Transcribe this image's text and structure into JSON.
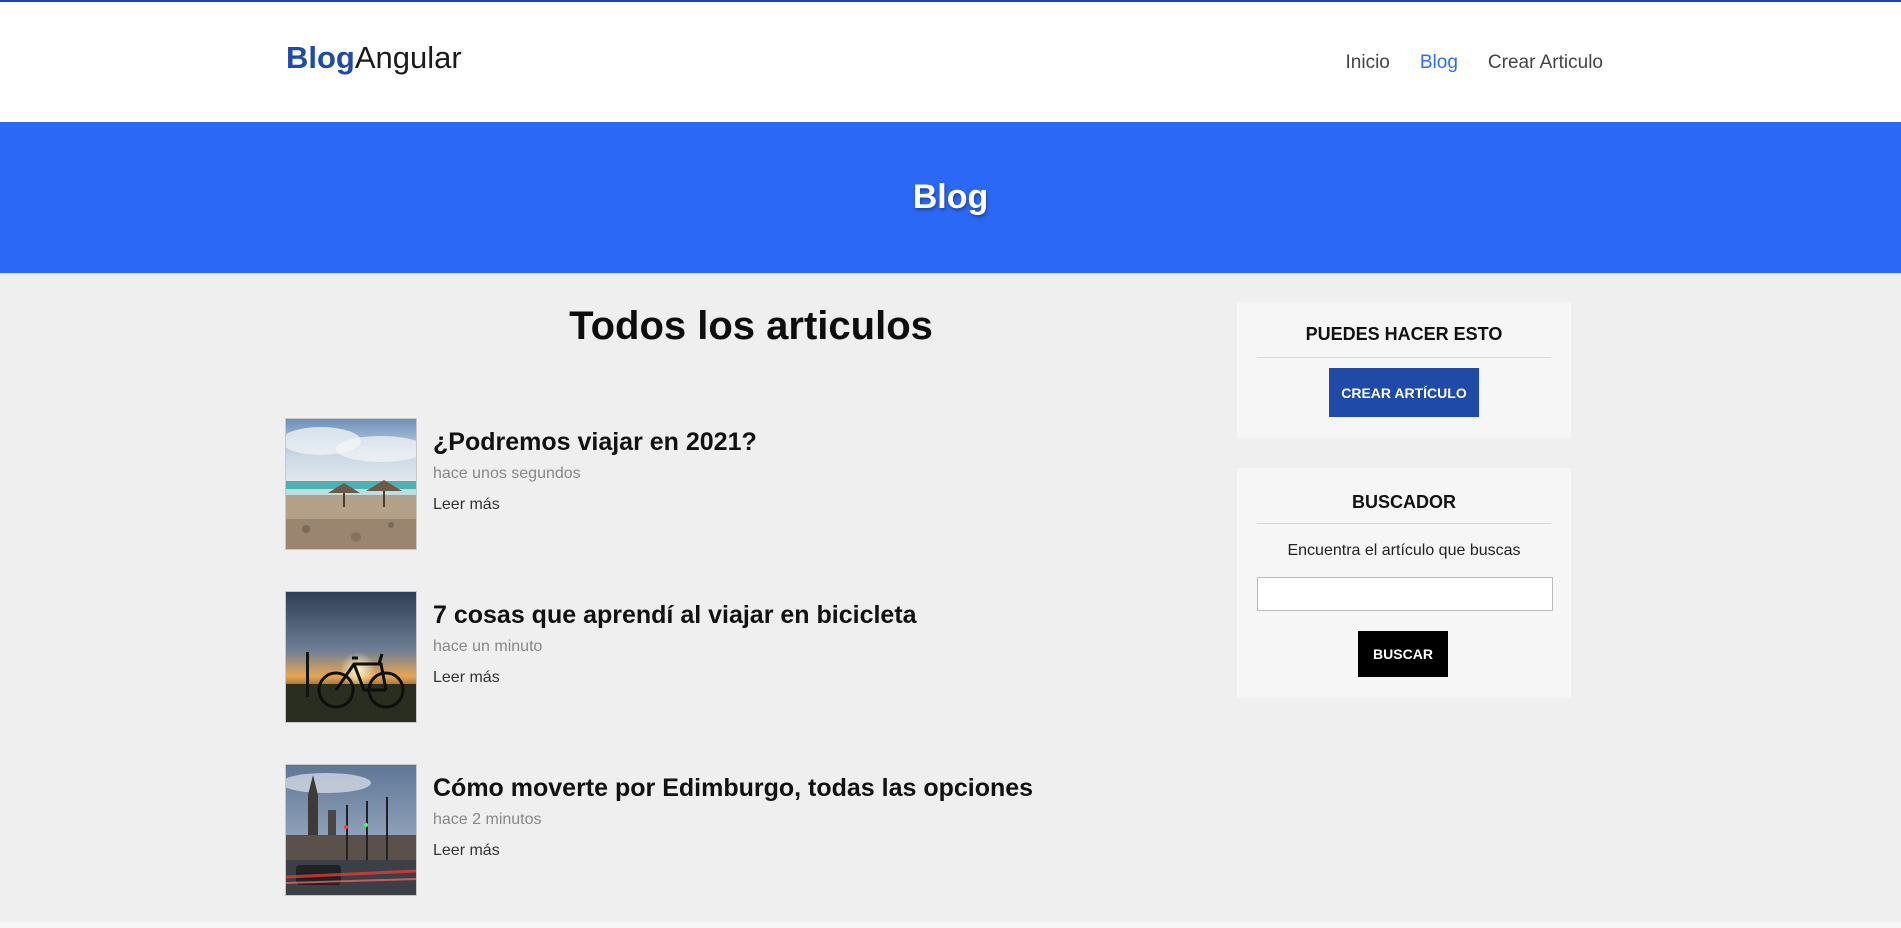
{
  "brand": {
    "part1": "Blog",
    "part2": "Angular"
  },
  "nav": [
    {
      "label": "Inicio",
      "active": false
    },
    {
      "label": "Blog",
      "active": true
    },
    {
      "label": "Crear Articulo",
      "active": false
    }
  ],
  "hero": {
    "title": "Blog"
  },
  "main": {
    "title": "Todos los articulos"
  },
  "articles": [
    {
      "title": "¿Podremos viajar en 2021?",
      "time": "hace unos segundos",
      "more": "Leer más",
      "image": "beach-umbrellas-photo"
    },
    {
      "title": "7 cosas que aprendí al viajar en bicicleta",
      "time": "hace un minuto",
      "more": "Leer más",
      "image": "bicycle-sunset-photo"
    },
    {
      "title": "Cómo moverte por Edimburgo, todas las opciones",
      "time": "hace 2 minutos",
      "more": "Leer más",
      "image": "edinburgh-street-photo"
    }
  ],
  "sidebar": {
    "actions": {
      "title": "PUEDES HACER ESTO",
      "button": "CREAR ARTÍCULO"
    },
    "search": {
      "title": "BUSCADOR",
      "description": "Encuentra el artículo que buscas",
      "value": "",
      "button": "BUSCAR"
    }
  },
  "colors": {
    "brand": "#1f4aa8",
    "hero": "#2b68f5",
    "nav_active": "#2f6df0",
    "background": "#efefef"
  }
}
